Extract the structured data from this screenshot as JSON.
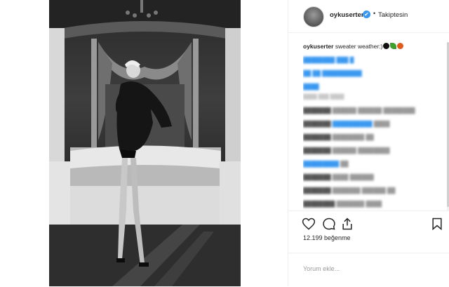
{
  "post": {
    "username": "oykuserter",
    "verified_mark": "✔",
    "separator": "•",
    "follow_label": "Takiptesin",
    "caption_user": "oykuserter",
    "caption_text": "sweater weather:)",
    "caption_emojis": [
      "black-heart",
      "leaf",
      "apple"
    ],
    "likes_label": "12.199 beğenme",
    "comment_placeholder": "Yorum ekle..."
  },
  "colors": {
    "verified": "#3897f0",
    "emoji_heart": "#111111",
    "emoji_leaf": "#3e9e2e",
    "emoji_apple": "#e05a1a"
  },
  "icons": {
    "like": "heart-icon",
    "comment": "comment-icon",
    "share": "share-icon",
    "save": "bookmark-icon"
  }
}
